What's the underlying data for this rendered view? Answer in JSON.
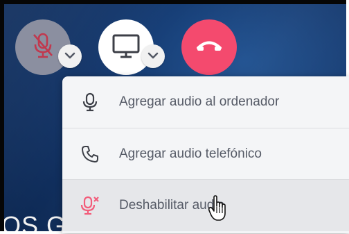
{
  "controls": {
    "mute_icon": "microphone-muted-icon",
    "screen_icon": "monitor-icon",
    "end_icon": "phone-hangup-icon",
    "chevron_icon": "chevron-down-icon"
  },
  "menu": {
    "items": [
      {
        "label": "Agregar audio al ordenador",
        "icon": "microphone-icon"
      },
      {
        "label": "Agregar audio telefónico",
        "icon": "phone-icon"
      },
      {
        "label": "Deshabilitar audio",
        "icon": "microphone-disabled-icon"
      }
    ]
  },
  "background": {
    "partial_text": "OS GLUTH FRUHU"
  },
  "colors": {
    "end_call": "#f44a6e",
    "mic_button": "#8b8fa0",
    "muted_mic_icon": "#c0394f",
    "disable_audio_icon": "#f25c7a",
    "menu_bg": "#f4f5f7",
    "menu_hover": "#e6e7ea"
  }
}
